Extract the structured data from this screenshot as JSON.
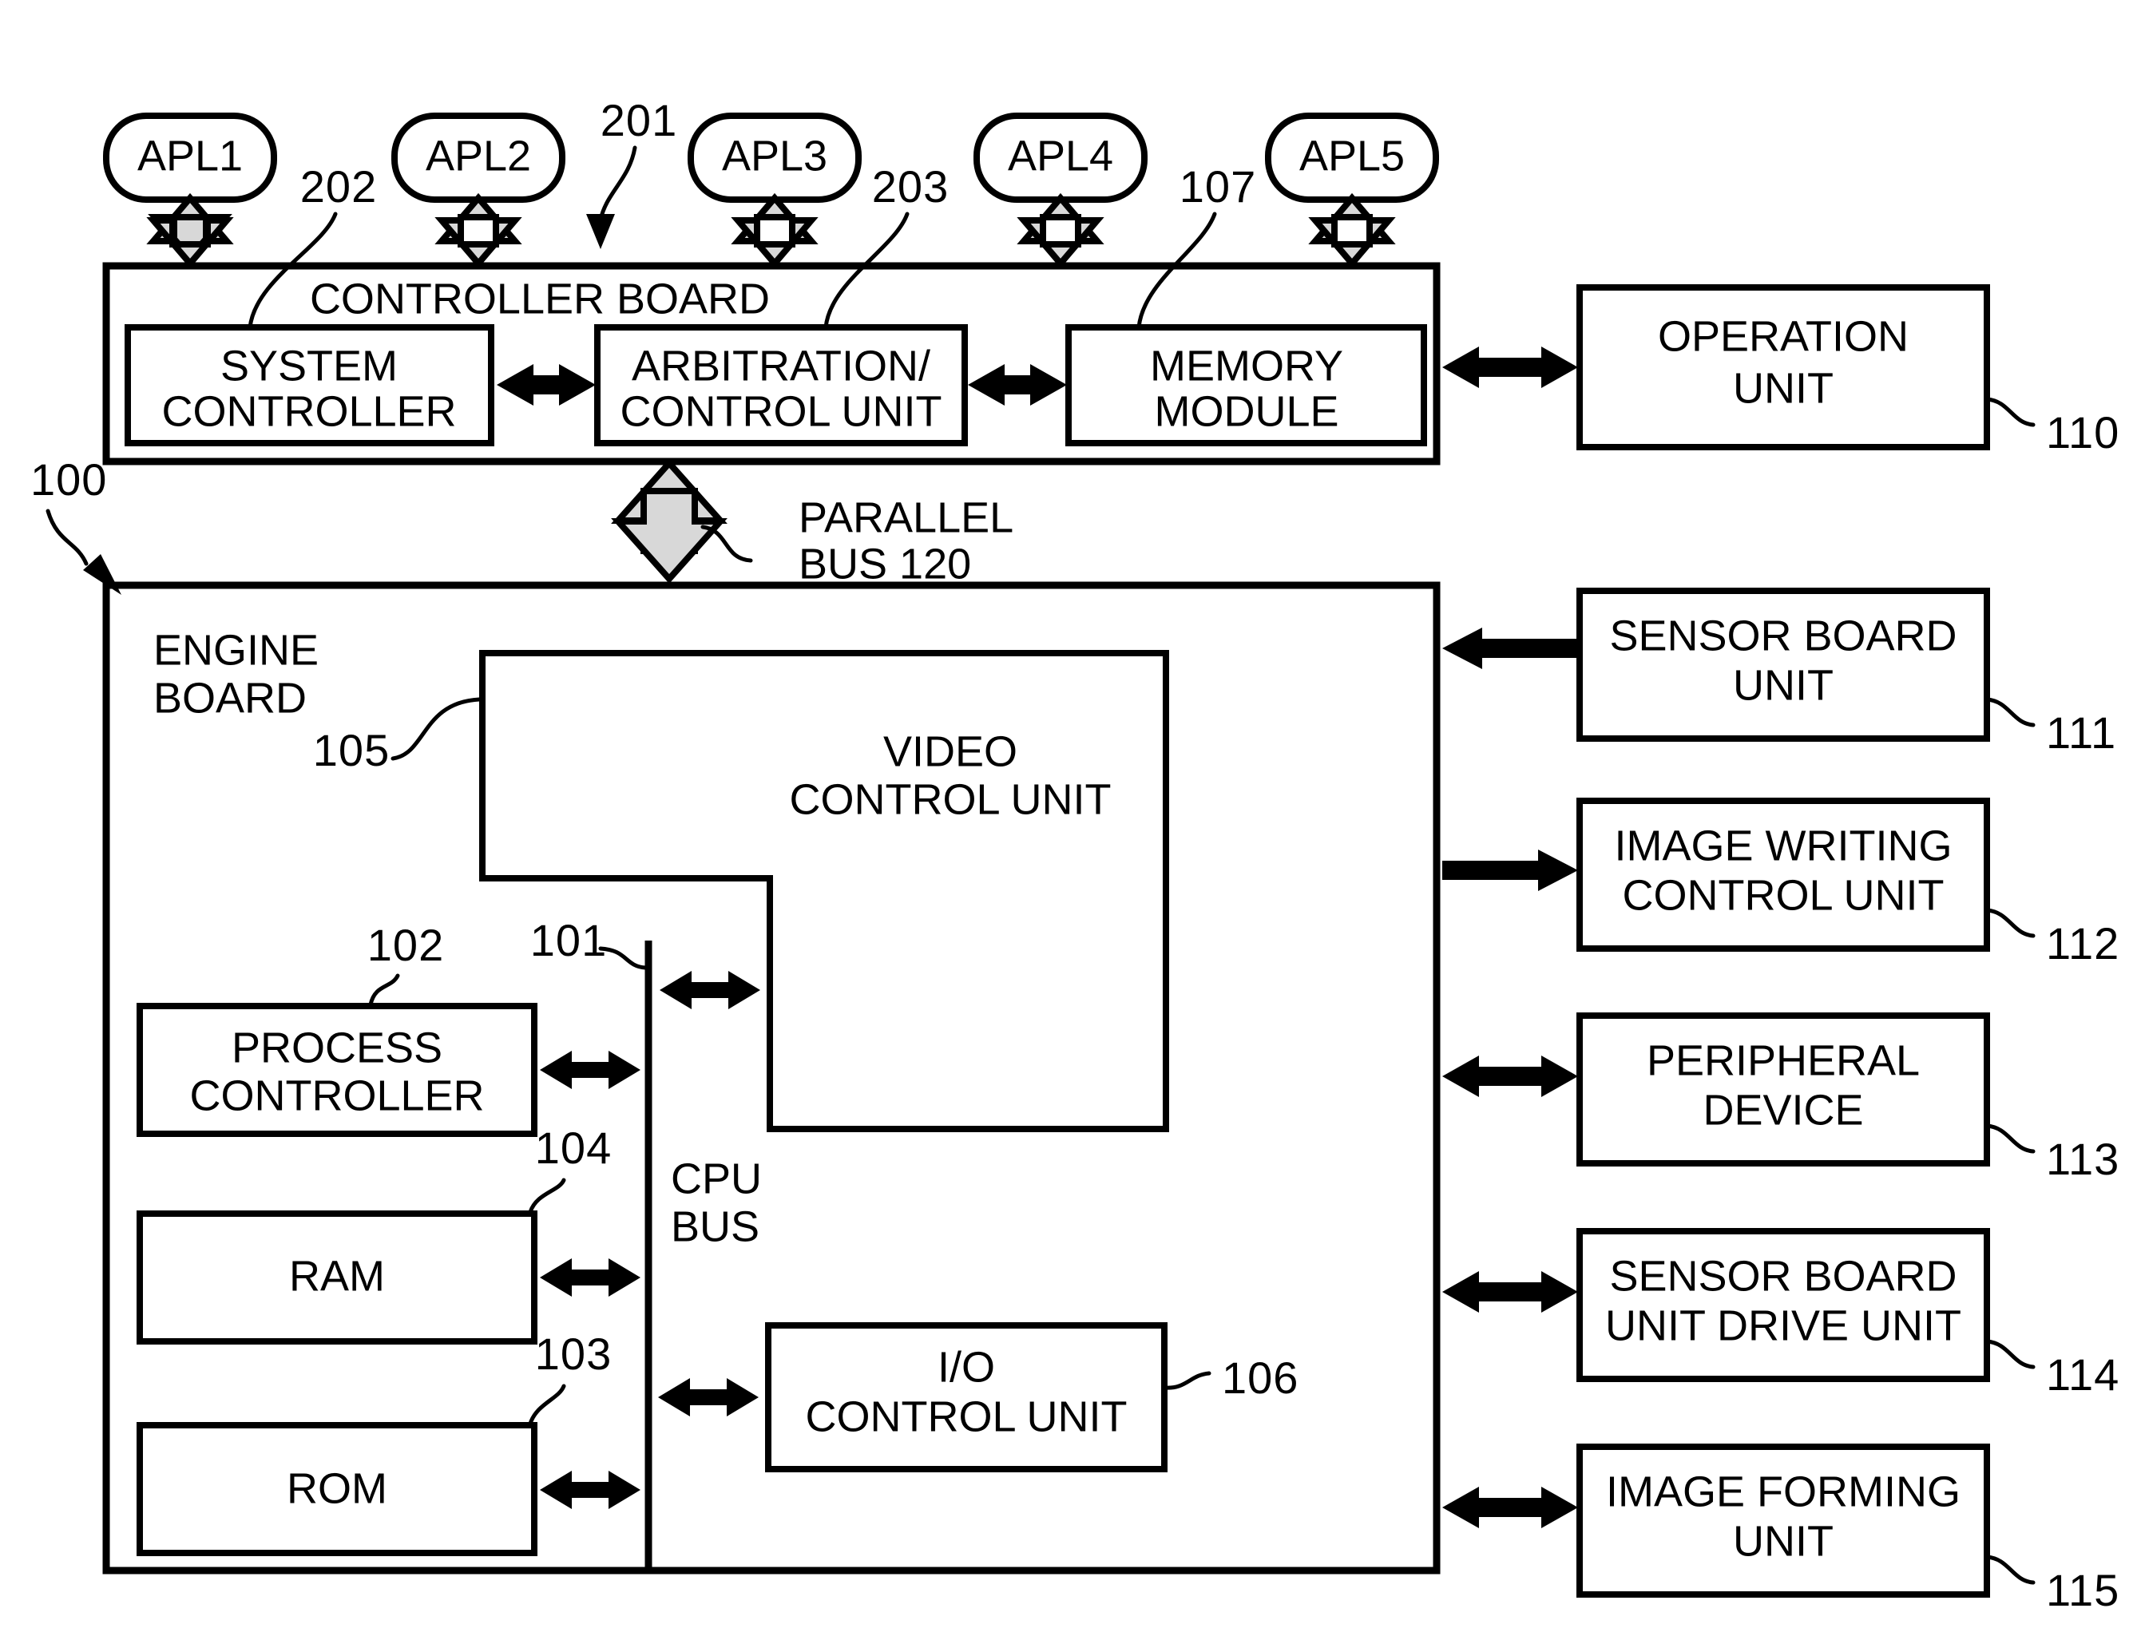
{
  "figure": {
    "type": "patent-block-diagram",
    "title": "Image forming apparatus controller/engine block diagram"
  },
  "applications": [
    {
      "label": "APL1"
    },
    {
      "label": "APL2"
    },
    {
      "label": "APL3"
    },
    {
      "label": "APL4"
    },
    {
      "label": "APL5"
    }
  ],
  "controller_board": {
    "label": "CONTROLLER BOARD",
    "ref": "201",
    "blocks": [
      {
        "label_line1": "SYSTEM",
        "label_line2": "CONTROLLER",
        "ref": "202"
      },
      {
        "label_line1": "ARBITRATION/",
        "label_line2": "CONTROL UNIT",
        "ref": "203"
      },
      {
        "label_line1": "MEMORY",
        "label_line2": "MODULE",
        "ref": "107"
      }
    ]
  },
  "parallel_bus": {
    "label_line1": "PARALLEL",
    "label_line2": "BUS 120"
  },
  "engine_board": {
    "label_line1": "ENGINE",
    "label_line2": "BOARD",
    "ref": "100",
    "blocks": [
      {
        "label_line1": "VIDEO",
        "label_line2": "CONTROL UNIT",
        "ref": "105"
      },
      {
        "label_line1": "PROCESS",
        "label_line2": "CONTROLLER",
        "ref": "102"
      },
      {
        "label_line1": "RAM",
        "label_line2": "",
        "ref": "104"
      },
      {
        "label_line1": "ROM",
        "label_line2": "",
        "ref": "103"
      },
      {
        "label_line1": "I/O",
        "label_line2": "CONTROL UNIT",
        "ref": "106"
      }
    ],
    "cpu_bus": {
      "label_line1": "CPU",
      "label_line2": "BUS",
      "ref": "101"
    }
  },
  "peripherals": [
    {
      "label_line1": "OPERATION",
      "label_line2": "UNIT",
      "ref": "110",
      "arrow": "bidirectional"
    },
    {
      "label_line1": "SENSOR BOARD",
      "label_line2": "UNIT",
      "ref": "111",
      "arrow": "left"
    },
    {
      "label_line1": "IMAGE WRITING",
      "label_line2": "CONTROL UNIT",
      "ref": "112",
      "arrow": "right"
    },
    {
      "label_line1": "PERIPHERAL",
      "label_line2": "DEVICE",
      "ref": "113",
      "arrow": "bidirectional"
    },
    {
      "label_line1": "SENSOR BOARD",
      "label_line2": "UNIT DRIVE UNIT",
      "ref": "114",
      "arrow": "bidirectional"
    },
    {
      "label_line1": "IMAGE FORMING",
      "label_line2": "UNIT",
      "ref": "115",
      "arrow": "bidirectional"
    }
  ],
  "colors": {
    "line": "#000000",
    "background": "#ffffff",
    "hollow_arrow_fill": "#d8d8d8"
  }
}
